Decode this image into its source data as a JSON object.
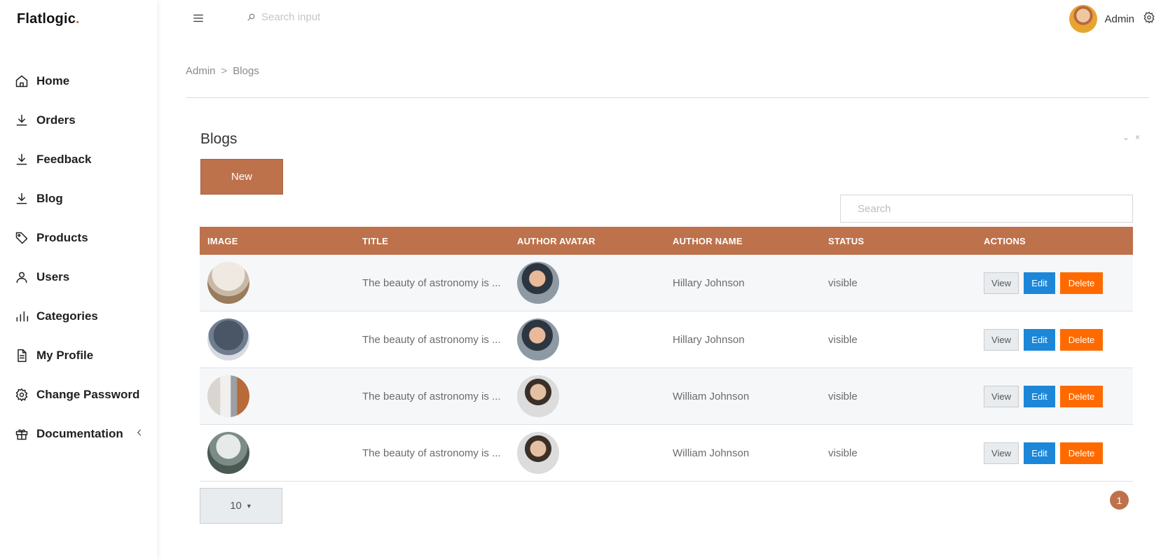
{
  "app": {
    "logo_text": "Flatlogic",
    "logo_dot": ".",
    "accent_color": "#bd724c"
  },
  "sidebar": {
    "items": [
      {
        "label": "Home",
        "icon": "home-icon"
      },
      {
        "label": "Orders",
        "icon": "download-icon"
      },
      {
        "label": "Feedback",
        "icon": "download-icon"
      },
      {
        "label": "Blog",
        "icon": "download-icon"
      },
      {
        "label": "Products",
        "icon": "tag-icon"
      },
      {
        "label": "Users",
        "icon": "user-icon"
      },
      {
        "label": "Categories",
        "icon": "bar-chart-icon"
      },
      {
        "label": "My Profile",
        "icon": "document-icon"
      },
      {
        "label": "Change Password",
        "icon": "gear-icon"
      },
      {
        "label": "Documentation",
        "icon": "gift-icon"
      }
    ]
  },
  "header": {
    "search_placeholder": "Search input",
    "user_name": "Admin"
  },
  "breadcrumb": {
    "root": "Admin",
    "separator": ">",
    "current": "Blogs"
  },
  "card": {
    "title": "Blogs",
    "new_button": "New",
    "search_placeholder": "Search",
    "tools": {
      "collapse": "⌄",
      "close": "×"
    }
  },
  "table": {
    "columns": [
      "IMAGE",
      "TITLE",
      "AUTHOR AVATAR",
      "AUTHOR NAME",
      "STATUS",
      "ACTIONS"
    ],
    "rows": [
      {
        "title": "The beauty of astronomy is ...",
        "author_name": "Hillary Johnson",
        "status": "visible"
      },
      {
        "title": "The beauty of astronomy is ...",
        "author_name": "Hillary Johnson",
        "status": "visible"
      },
      {
        "title": "The beauty of astronomy is ...",
        "author_name": "William Johnson",
        "status": "visible"
      },
      {
        "title": "The beauty of astronomy is ...",
        "author_name": "William Johnson",
        "status": "visible"
      }
    ],
    "actions": {
      "view": "View",
      "edit": "Edit",
      "delete": "Delete"
    }
  },
  "pagination": {
    "page_size": "10",
    "current_page": "1"
  }
}
